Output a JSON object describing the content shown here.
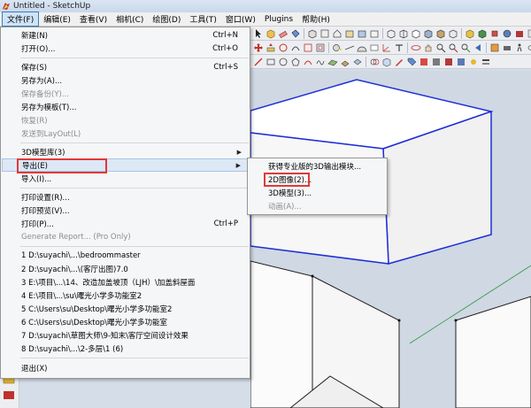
{
  "window": {
    "title": "Untitled - SketchUp",
    "icon": "sketchup-logo-icon"
  },
  "menubar": {
    "items": [
      "文件(F)",
      "编辑(E)",
      "查看(V)",
      "相机(C)",
      "绘图(D)",
      "工具(T)",
      "窗口(W)",
      "Plugins",
      "帮助(H)"
    ],
    "active_index": 0
  },
  "file_menu": {
    "items": [
      {
        "label": "新建(N)",
        "shortcut": "Ctrl+N",
        "enabled": true
      },
      {
        "label": "打开(O)...",
        "shortcut": "Ctrl+O",
        "enabled": true
      },
      {
        "label": "保存(S)",
        "shortcut": "Ctrl+S",
        "enabled": true
      },
      {
        "label": "另存为(A)...",
        "shortcut": "",
        "enabled": true
      },
      {
        "label": "保存备份(Y)...",
        "shortcut": "",
        "enabled": false
      },
      {
        "label": "另存为模板(T)...",
        "shortcut": "",
        "enabled": true
      },
      {
        "label": "恢复(R)",
        "shortcut": "",
        "enabled": false
      },
      {
        "label": "发送到LayOut(L)",
        "shortcut": "",
        "enabled": false
      },
      {
        "label": "3D模型库(3)",
        "shortcut": "",
        "enabled": true,
        "submenu": true
      },
      {
        "label": "导出(E)",
        "shortcut": "",
        "enabled": true,
        "submenu": true,
        "highlighted": true
      },
      {
        "label": "导入(I)...",
        "shortcut": "",
        "enabled": true
      },
      {
        "label": "打印设置(R)...",
        "shortcut": "",
        "enabled": true
      },
      {
        "label": "打印预览(V)...",
        "shortcut": "",
        "enabled": true
      },
      {
        "label": "打印(P)...",
        "shortcut": "Ctrl+P",
        "enabled": true
      },
      {
        "label": "Generate Report... (Pro Only)",
        "shortcut": "",
        "enabled": false
      },
      {
        "label": "1 D:\\suyachi\\...\\bedroommaster",
        "shortcut": "",
        "enabled": true
      },
      {
        "label": "2 D:\\suyachi\\...\\(客厅出图)7.0",
        "shortcut": "",
        "enabled": true
      },
      {
        "label": "3 E:\\项目\\...\\14、改造加盖坡顶（LJH）\\加盖斜屋面",
        "shortcut": "",
        "enabled": true
      },
      {
        "label": "4 E:\\项目\\...\\su\\曙光小学多功能室2",
        "shortcut": "",
        "enabled": true
      },
      {
        "label": "5 C:\\Users\\su\\Desktop\\曙光小学多功能室2",
        "shortcut": "",
        "enabled": true
      },
      {
        "label": "6 C:\\Users\\su\\Desktop\\曙光小学多功能室",
        "shortcut": "",
        "enabled": true
      },
      {
        "label": "7 D:\\suyachi\\草图大师\\9-知末\\客厅空间设计效果",
        "shortcut": "",
        "enabled": true
      },
      {
        "label": "8 D:\\suyachi\\...\\2-多层\\1 (6)",
        "shortcut": "",
        "enabled": true
      },
      {
        "label": "退出(X)",
        "shortcut": "",
        "enabled": true
      }
    ]
  },
  "export_submenu": {
    "items": [
      {
        "label": "获得专业版的3D输出模块...",
        "enabled": true
      },
      {
        "label": "2D图像(2)...",
        "enabled": true,
        "highlighted": true
      },
      {
        "label": "3D模型(3)...",
        "enabled": true
      },
      {
        "label": "动画(A)...",
        "enabled": false
      }
    ]
  },
  "colors": {
    "highlight_box": "#e23838",
    "selection_edges": "#1f2fd6",
    "axis_green": "#2e9a3a",
    "sky": "#cfd8e3"
  }
}
